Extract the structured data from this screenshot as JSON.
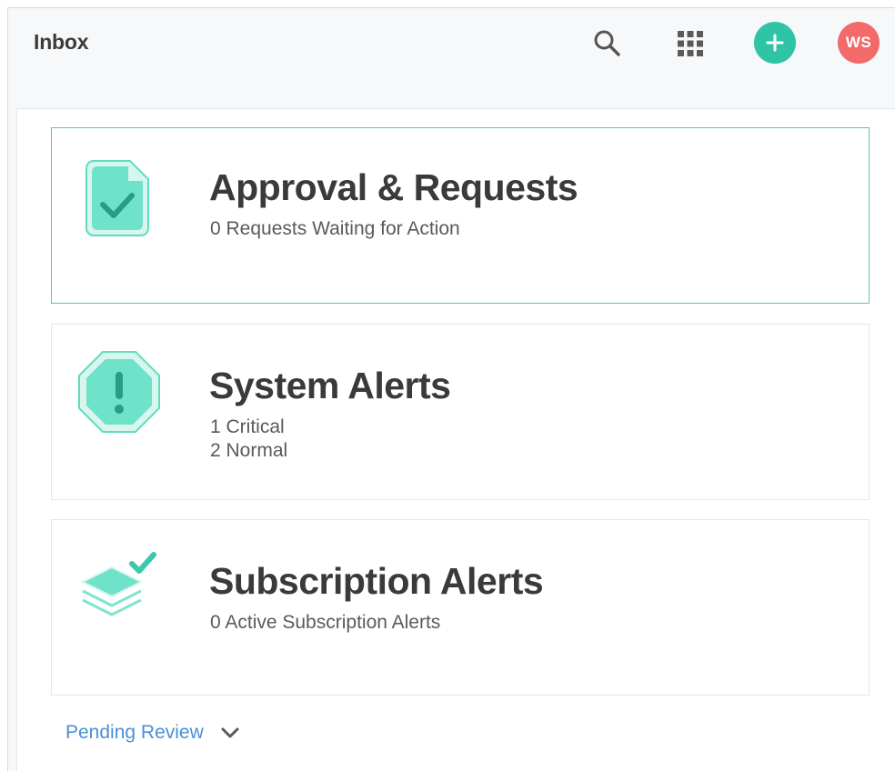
{
  "header": {
    "title": "Inbox",
    "search_icon": "search-icon",
    "apps_icon": "grid-icon",
    "add_icon": "plus-icon",
    "avatar_initials": "WS",
    "accent_color": "#2fc4a6",
    "avatar_color": "#f26a6a"
  },
  "cards": [
    {
      "icon": "document-check-icon",
      "title": "Approval & Requests",
      "lines": [
        "0 Requests Waiting for Action"
      ],
      "active": true
    },
    {
      "icon": "alert-octagon-icon",
      "title": "System Alerts",
      "lines": [
        "1 Critical",
        "2 Normal"
      ],
      "active": false
    },
    {
      "icon": "layers-check-icon",
      "title": "Subscription Alerts",
      "lines": [
        "0 Active Subscription Alerts"
      ],
      "active": false
    }
  ],
  "footer": {
    "pending_label": "Pending Review",
    "pending_icon": "chevron-down-icon",
    "link_color": "#4a8fd6"
  }
}
